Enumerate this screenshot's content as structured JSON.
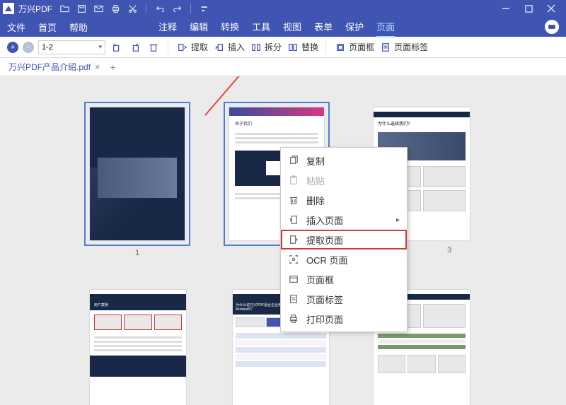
{
  "titlebar": {
    "title": "万兴PDF"
  },
  "menubar": {
    "left": [
      "文件",
      "首页",
      "帮助"
    ],
    "right": [
      "注释",
      "编辑",
      "转换",
      "工具",
      "视图",
      "表单",
      "保护",
      "页面"
    ],
    "active_index": 7
  },
  "toolbar": {
    "page_range": "1-2",
    "extract": "提取",
    "insert": "插入",
    "split": "拆分",
    "replace": "替换",
    "pagebox": "页面框",
    "pagelabel": "页面标签"
  },
  "tabs": {
    "items": [
      {
        "label": "万兴PDF产品介绍.pdf"
      }
    ]
  },
  "pages": {
    "p1": "1",
    "p3": "3"
  },
  "context_menu": {
    "copy": "复制",
    "paste": "粘贴",
    "delete": "删除",
    "insert_page": "插入页面",
    "extract_page": "提取页面",
    "ocr_page": "OCR 页面",
    "page_box": "页面框",
    "page_label": "页面标签",
    "print_page": "打印页面"
  }
}
